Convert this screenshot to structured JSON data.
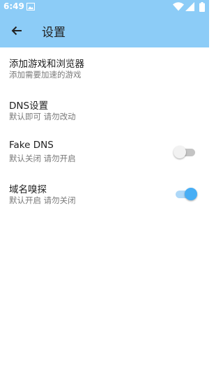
{
  "status_bar": {
    "time": "6:49",
    "color": "#8cccf7"
  },
  "app_bar": {
    "title": "设置",
    "back_icon": "arrow-back-icon"
  },
  "settings": [
    {
      "title": "添加游戏和浏览器",
      "summary": "添加需要加速的游戏"
    },
    {
      "title": "DNS设置",
      "summary": "默认即可 请勿改动"
    },
    {
      "title": "Fake DNS",
      "summary": "默认关闭 请勿开启",
      "switch_on": false
    },
    {
      "title": "域名嗅探",
      "summary": "默认开启 请勿关闭",
      "switch_on": true
    }
  ],
  "colors": {
    "accent": "#47aef5",
    "switch_track_on": "#aed8f8",
    "switch_track_off": "#c4c4c4"
  }
}
